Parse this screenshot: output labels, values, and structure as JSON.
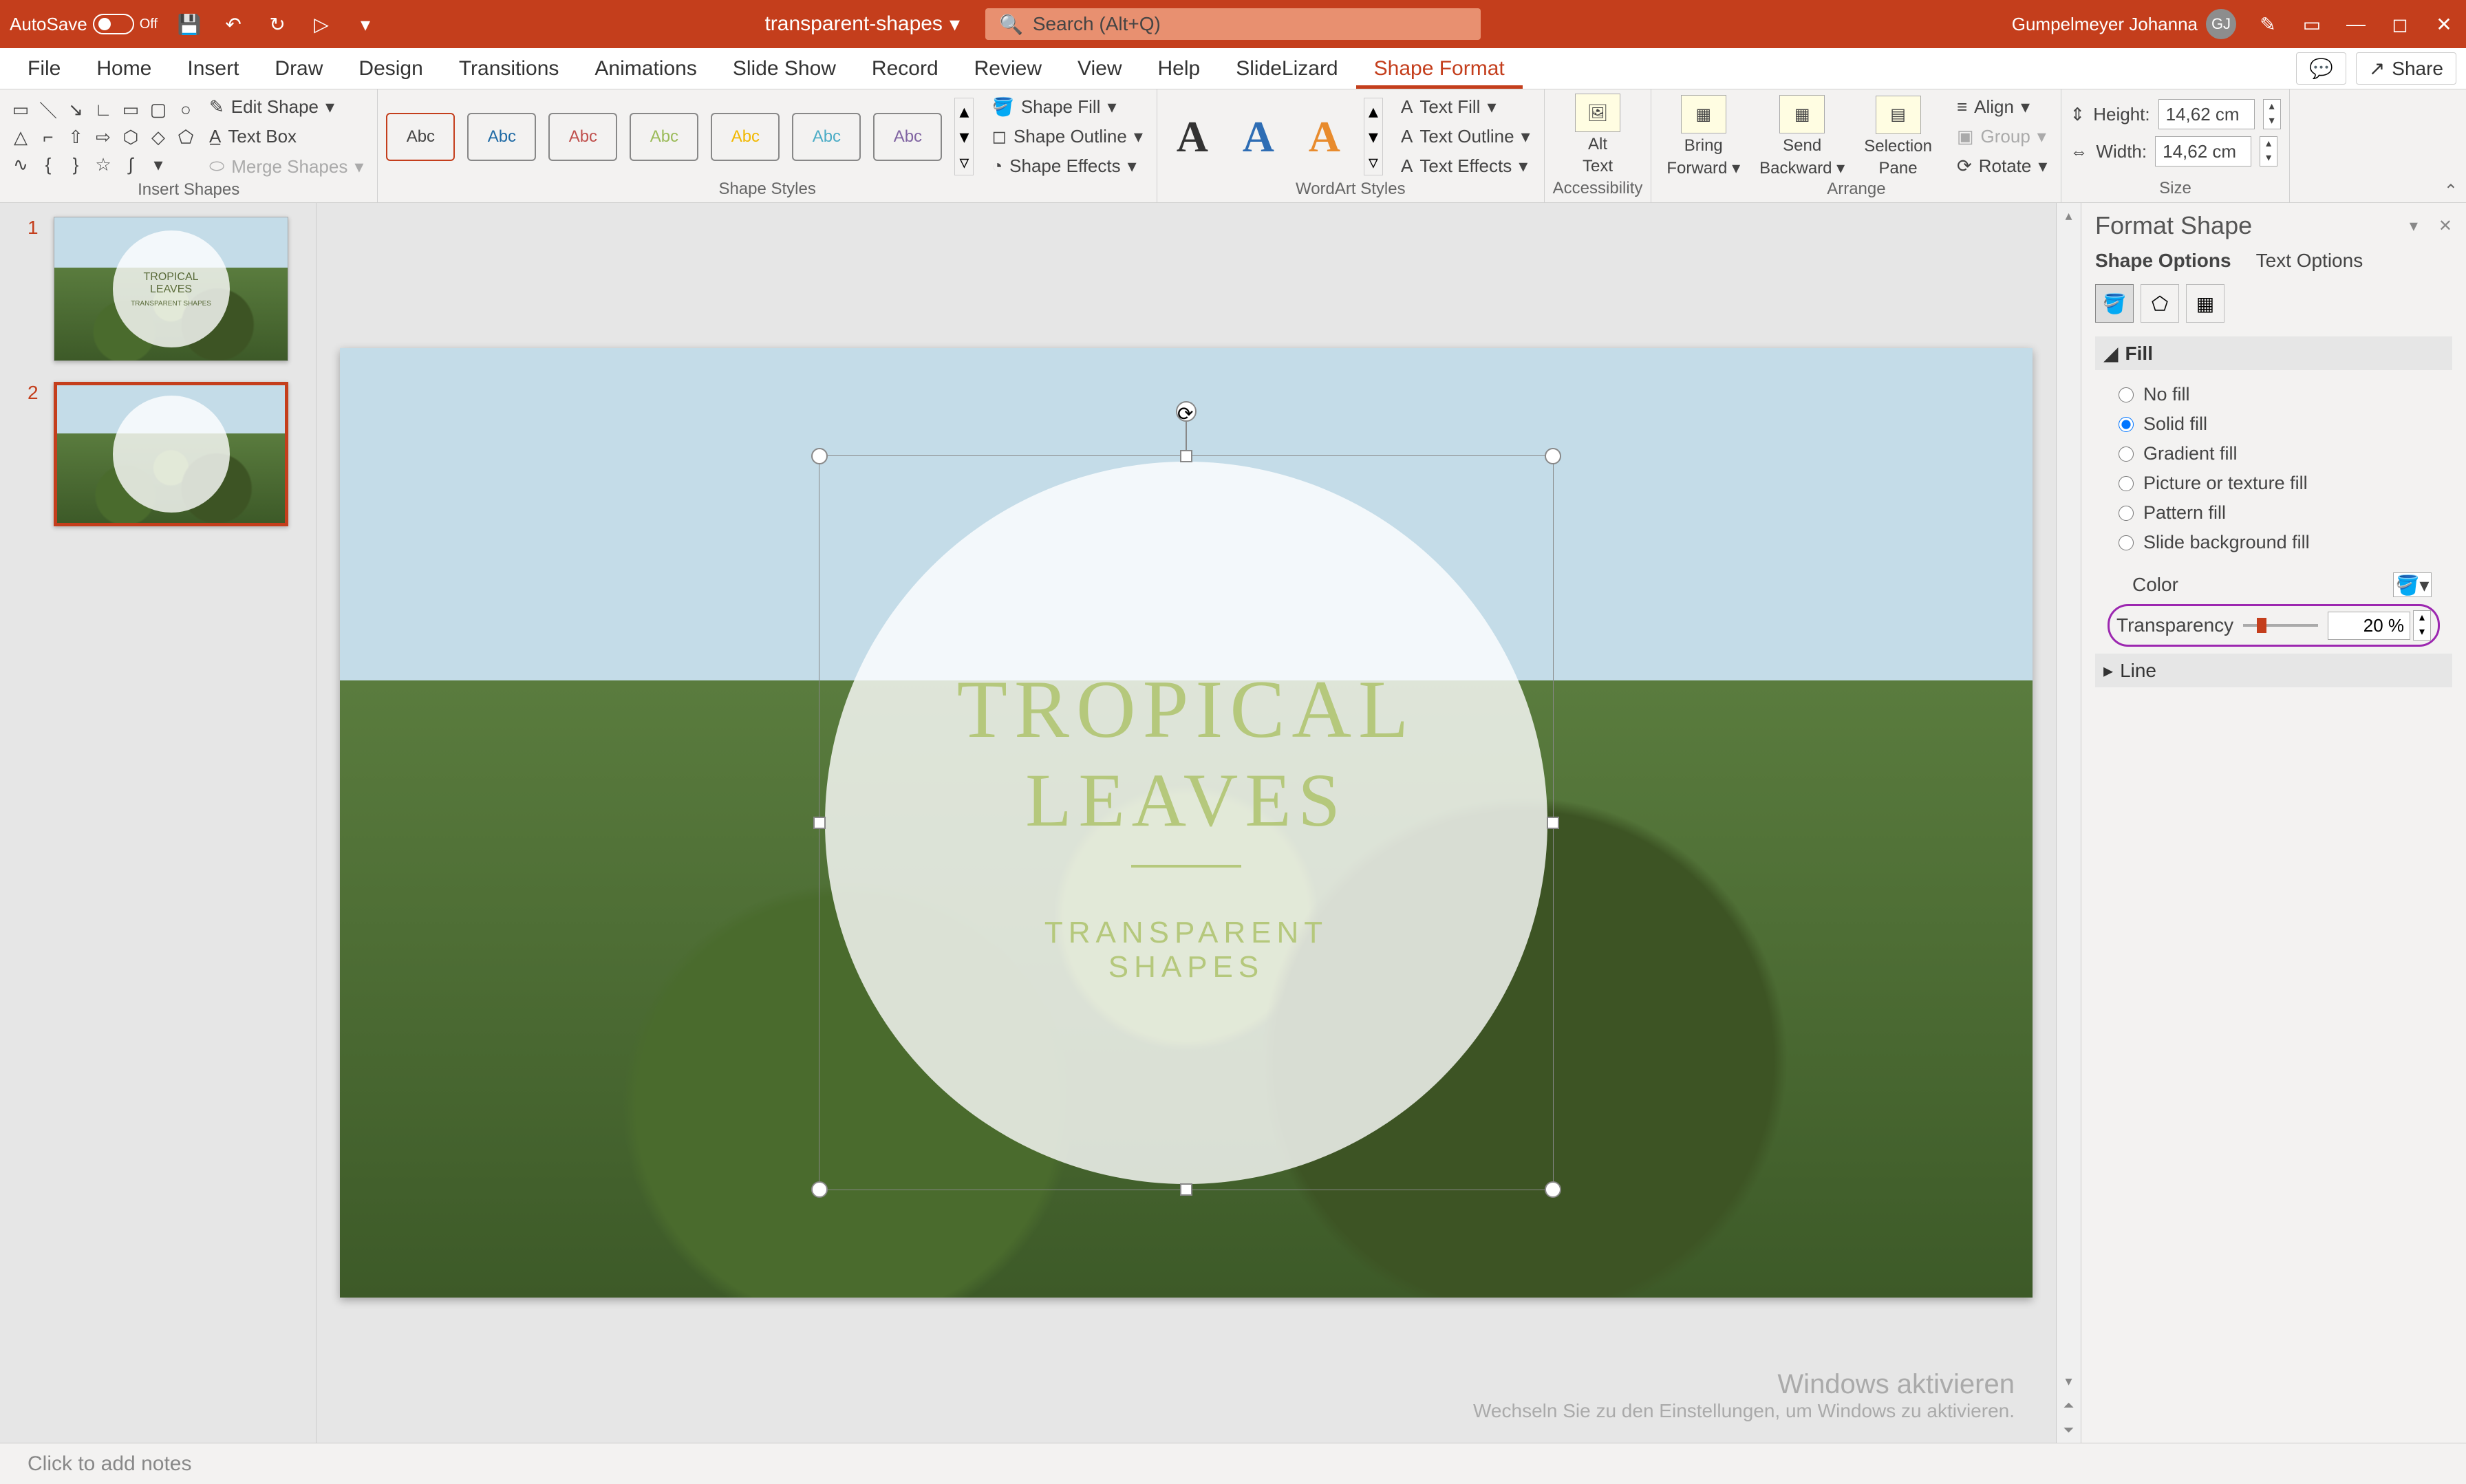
{
  "titlebar": {
    "autosave_label": "AutoSave",
    "autosave_state": "Off",
    "doc_name": "transparent-shapes",
    "search_placeholder": "Search (Alt+Q)",
    "user_name": "Gumpelmeyer Johanna",
    "user_initials": "GJ"
  },
  "tabs": {
    "items": [
      "File",
      "Home",
      "Insert",
      "Draw",
      "Design",
      "Transitions",
      "Animations",
      "Slide Show",
      "Record",
      "Review",
      "View",
      "Help",
      "SlideLizard",
      "Shape Format"
    ],
    "active": "Shape Format",
    "share_label": "Share"
  },
  "ribbon": {
    "insert_shapes": {
      "edit_shape": "Edit Shape",
      "text_box": "Text Box",
      "merge_shapes": "Merge Shapes",
      "group_label": "Insert Shapes"
    },
    "shape_styles": {
      "thumb_label": "Abc",
      "shape_fill": "Shape Fill",
      "shape_outline": "Shape Outline",
      "shape_effects": "Shape Effects",
      "group_label": "Shape Styles"
    },
    "wordart_styles": {
      "glyph": "A",
      "text_fill": "Text Fill",
      "text_outline": "Text Outline",
      "text_effects": "Text Effects",
      "group_label": "WordArt Styles"
    },
    "accessibility": {
      "alt_text_1": "Alt",
      "alt_text_2": "Text",
      "group_label": "Accessibility"
    },
    "arrange": {
      "bring_forward_1": "Bring",
      "bring_forward_2": "Forward",
      "send_backward_1": "Send",
      "send_backward_2": "Backward",
      "selection_pane_1": "Selection",
      "selection_pane_2": "Pane",
      "align": "Align",
      "group": "Group",
      "rotate": "Rotate",
      "group_label": "Arrange"
    },
    "size": {
      "height_label": "Height:",
      "height_val": "14,62 cm",
      "width_label": "Width:",
      "width_val": "14,62 cm",
      "group_label": "Size"
    }
  },
  "thumbs": {
    "slides": [
      {
        "num": "1",
        "title1": "TROPICAL",
        "title2": "LEAVES",
        "sub": "TRANSPARENT SHAPES"
      },
      {
        "num": "2"
      }
    ]
  },
  "canvas": {
    "title1": "TROPICAL",
    "title2": "LEAVES",
    "sub1": "TRANSPARENT",
    "sub2": "SHAPES"
  },
  "watermark": {
    "line1": "Windows aktivieren",
    "line2": "Wechseln Sie zu den Einstellungen, um Windows zu aktivieren."
  },
  "pane": {
    "title": "Format Shape",
    "opt1": "Shape Options",
    "opt2": "Text Options",
    "section_fill": "Fill",
    "fill_options": {
      "no_fill": "No fill",
      "solid_fill": "Solid fill",
      "gradient_fill": "Gradient fill",
      "picture_fill": "Picture or texture fill",
      "pattern_fill": "Pattern fill",
      "slide_bg_fill": "Slide background fill"
    },
    "color_label": "Color",
    "transparency_label": "Transparency",
    "transparency_value": "20 %",
    "section_line": "Line"
  },
  "notes": {
    "placeholder": "Click to add notes"
  }
}
